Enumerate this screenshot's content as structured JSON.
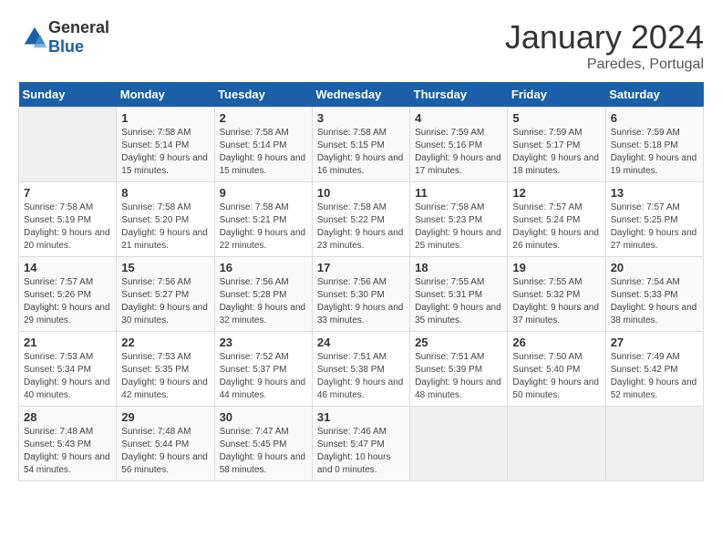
{
  "header": {
    "logo_general": "General",
    "logo_blue": "Blue",
    "month_title": "January 2024",
    "location": "Paredes, Portugal"
  },
  "weekdays": [
    "Sunday",
    "Monday",
    "Tuesday",
    "Wednesday",
    "Thursday",
    "Friday",
    "Saturday"
  ],
  "weeks": [
    [
      {
        "day": "",
        "sunrise": "",
        "sunset": "",
        "daylight": ""
      },
      {
        "day": "1",
        "sunrise": "Sunrise: 7:58 AM",
        "sunset": "Sunset: 5:14 PM",
        "daylight": "Daylight: 9 hours and 15 minutes."
      },
      {
        "day": "2",
        "sunrise": "Sunrise: 7:58 AM",
        "sunset": "Sunset: 5:14 PM",
        "daylight": "Daylight: 9 hours and 15 minutes."
      },
      {
        "day": "3",
        "sunrise": "Sunrise: 7:58 AM",
        "sunset": "Sunset: 5:15 PM",
        "daylight": "Daylight: 9 hours and 16 minutes."
      },
      {
        "day": "4",
        "sunrise": "Sunrise: 7:59 AM",
        "sunset": "Sunset: 5:16 PM",
        "daylight": "Daylight: 9 hours and 17 minutes."
      },
      {
        "day": "5",
        "sunrise": "Sunrise: 7:59 AM",
        "sunset": "Sunset: 5:17 PM",
        "daylight": "Daylight: 9 hours and 18 minutes."
      },
      {
        "day": "6",
        "sunrise": "Sunrise: 7:59 AM",
        "sunset": "Sunset: 5:18 PM",
        "daylight": "Daylight: 9 hours and 19 minutes."
      }
    ],
    [
      {
        "day": "7",
        "sunrise": "Sunrise: 7:58 AM",
        "sunset": "Sunset: 5:19 PM",
        "daylight": "Daylight: 9 hours and 20 minutes."
      },
      {
        "day": "8",
        "sunrise": "Sunrise: 7:58 AM",
        "sunset": "Sunset: 5:20 PM",
        "daylight": "Daylight: 9 hours and 21 minutes."
      },
      {
        "day": "9",
        "sunrise": "Sunrise: 7:58 AM",
        "sunset": "Sunset: 5:21 PM",
        "daylight": "Daylight: 9 hours and 22 minutes."
      },
      {
        "day": "10",
        "sunrise": "Sunrise: 7:58 AM",
        "sunset": "Sunset: 5:22 PM",
        "daylight": "Daylight: 9 hours and 23 minutes."
      },
      {
        "day": "11",
        "sunrise": "Sunrise: 7:58 AM",
        "sunset": "Sunset: 5:23 PM",
        "daylight": "Daylight: 9 hours and 25 minutes."
      },
      {
        "day": "12",
        "sunrise": "Sunrise: 7:57 AM",
        "sunset": "Sunset: 5:24 PM",
        "daylight": "Daylight: 9 hours and 26 minutes."
      },
      {
        "day": "13",
        "sunrise": "Sunrise: 7:57 AM",
        "sunset": "Sunset: 5:25 PM",
        "daylight": "Daylight: 9 hours and 27 minutes."
      }
    ],
    [
      {
        "day": "14",
        "sunrise": "Sunrise: 7:57 AM",
        "sunset": "Sunset: 5:26 PM",
        "daylight": "Daylight: 9 hours and 29 minutes."
      },
      {
        "day": "15",
        "sunrise": "Sunrise: 7:56 AM",
        "sunset": "Sunset: 5:27 PM",
        "daylight": "Daylight: 9 hours and 30 minutes."
      },
      {
        "day": "16",
        "sunrise": "Sunrise: 7:56 AM",
        "sunset": "Sunset: 5:28 PM",
        "daylight": "Daylight: 9 hours and 32 minutes."
      },
      {
        "day": "17",
        "sunrise": "Sunrise: 7:56 AM",
        "sunset": "Sunset: 5:30 PM",
        "daylight": "Daylight: 9 hours and 33 minutes."
      },
      {
        "day": "18",
        "sunrise": "Sunrise: 7:55 AM",
        "sunset": "Sunset: 5:31 PM",
        "daylight": "Daylight: 9 hours and 35 minutes."
      },
      {
        "day": "19",
        "sunrise": "Sunrise: 7:55 AM",
        "sunset": "Sunset: 5:32 PM",
        "daylight": "Daylight: 9 hours and 37 minutes."
      },
      {
        "day": "20",
        "sunrise": "Sunrise: 7:54 AM",
        "sunset": "Sunset: 5:33 PM",
        "daylight": "Daylight: 9 hours and 38 minutes."
      }
    ],
    [
      {
        "day": "21",
        "sunrise": "Sunrise: 7:53 AM",
        "sunset": "Sunset: 5:34 PM",
        "daylight": "Daylight: 9 hours and 40 minutes."
      },
      {
        "day": "22",
        "sunrise": "Sunrise: 7:53 AM",
        "sunset": "Sunset: 5:35 PM",
        "daylight": "Daylight: 9 hours and 42 minutes."
      },
      {
        "day": "23",
        "sunrise": "Sunrise: 7:52 AM",
        "sunset": "Sunset: 5:37 PM",
        "daylight": "Daylight: 9 hours and 44 minutes."
      },
      {
        "day": "24",
        "sunrise": "Sunrise: 7:51 AM",
        "sunset": "Sunset: 5:38 PM",
        "daylight": "Daylight: 9 hours and 46 minutes."
      },
      {
        "day": "25",
        "sunrise": "Sunrise: 7:51 AM",
        "sunset": "Sunset: 5:39 PM",
        "daylight": "Daylight: 9 hours and 48 minutes."
      },
      {
        "day": "26",
        "sunrise": "Sunrise: 7:50 AM",
        "sunset": "Sunset: 5:40 PM",
        "daylight": "Daylight: 9 hours and 50 minutes."
      },
      {
        "day": "27",
        "sunrise": "Sunrise: 7:49 AM",
        "sunset": "Sunset: 5:42 PM",
        "daylight": "Daylight: 9 hours and 52 minutes."
      }
    ],
    [
      {
        "day": "28",
        "sunrise": "Sunrise: 7:48 AM",
        "sunset": "Sunset: 5:43 PM",
        "daylight": "Daylight: 9 hours and 54 minutes."
      },
      {
        "day": "29",
        "sunrise": "Sunrise: 7:48 AM",
        "sunset": "Sunset: 5:44 PM",
        "daylight": "Daylight: 9 hours and 56 minutes."
      },
      {
        "day": "30",
        "sunrise": "Sunrise: 7:47 AM",
        "sunset": "Sunset: 5:45 PM",
        "daylight": "Daylight: 9 hours and 58 minutes."
      },
      {
        "day": "31",
        "sunrise": "Sunrise: 7:46 AM",
        "sunset": "Sunset: 5:47 PM",
        "daylight": "Daylight: 10 hours and 0 minutes."
      },
      {
        "day": "",
        "sunrise": "",
        "sunset": "",
        "daylight": ""
      },
      {
        "day": "",
        "sunrise": "",
        "sunset": "",
        "daylight": ""
      },
      {
        "day": "",
        "sunrise": "",
        "sunset": "",
        "daylight": ""
      }
    ]
  ]
}
